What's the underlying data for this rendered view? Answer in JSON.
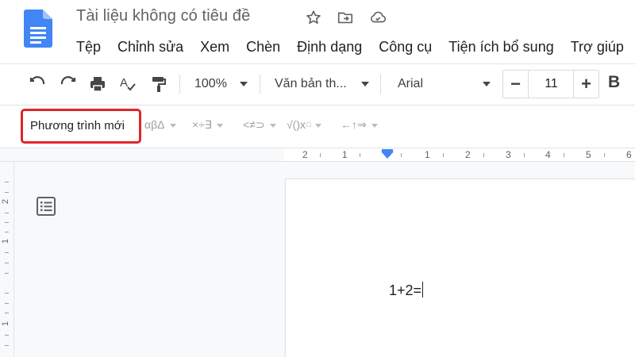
{
  "document": {
    "title": "Tài liệu không có tiêu đề"
  },
  "menu": {
    "items": [
      "Tệp",
      "Chỉnh sửa",
      "Xem",
      "Chèn",
      "Định dạng",
      "Công cụ",
      "Tiện ích bổ sung",
      "Trợ giúp"
    ]
  },
  "toolbar": {
    "zoom": "100%",
    "style": "Văn bản th...",
    "font": "Arial",
    "font_size": "11",
    "minus": "−",
    "plus": "+",
    "bold": "B"
  },
  "equation_bar": {
    "new_equation": "Phương trình mới",
    "greek": "αβΔ",
    "operators": "×÷∃",
    "relations": "<≠⊃",
    "math": "√()x",
    "arrows": "←↑⇒"
  },
  "ruler": {
    "labels": [
      "2",
      "1",
      "1",
      "2",
      "3",
      "4",
      "5",
      "6"
    ]
  },
  "vertical_ruler": {
    "labels": [
      "2",
      "1",
      "1"
    ]
  },
  "page": {
    "text": "1+2="
  },
  "colors": {
    "brand_blue": "#4285f4",
    "highlight_red": "#e0242b"
  }
}
